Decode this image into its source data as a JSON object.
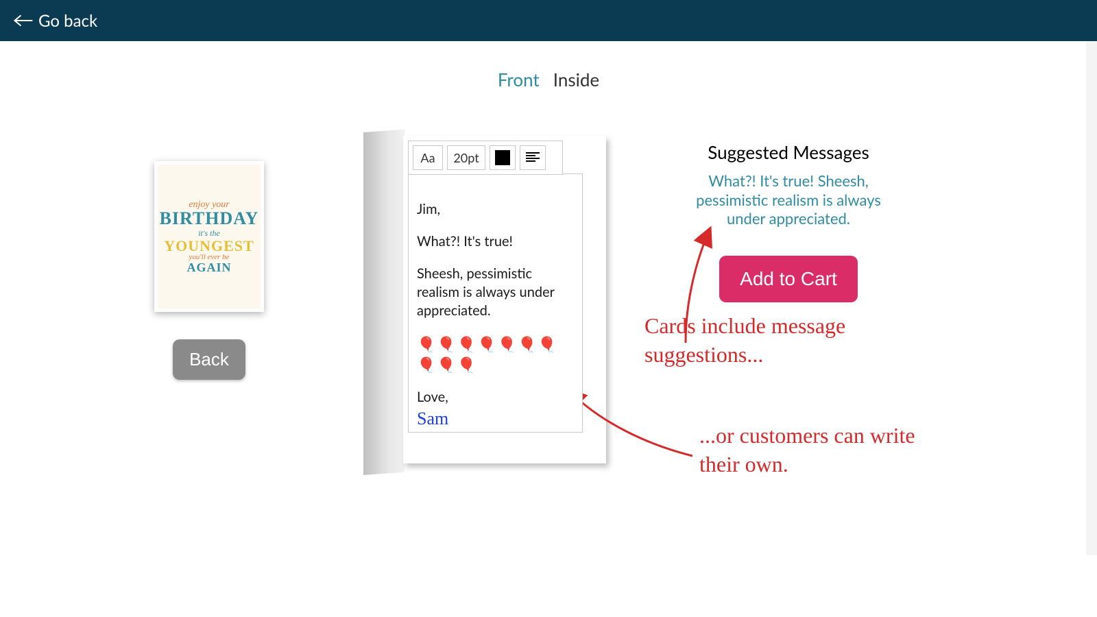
{
  "topbar": {
    "go_back": "Go back"
  },
  "tabs": {
    "front": "Front",
    "inside": "Inside",
    "active": "front"
  },
  "thumbnail": {
    "line1": "enjoy your",
    "line2": "BIRTHDAY",
    "line3": "it's the",
    "line4": "YOUNGEST",
    "line5": "you'll ever be",
    "line6": "AGAIN"
  },
  "left": {
    "back_button": "Back"
  },
  "toolbar": {
    "font_button": "Aa",
    "size_button": "20pt",
    "color_swatch": "#000000",
    "align_button": "align-left"
  },
  "message": {
    "greeting": "Jim,",
    "line1": "What?! It's true!",
    "line2": "Sheesh, pessimistic realism is always under appreciated.",
    "balloons": "🎈🎈🎈🎈🎈🎈🎈🎈🎈🎈",
    "closing": "Love,",
    "signature": "Sam"
  },
  "right": {
    "suggested_title": "Suggested Messages",
    "suggested_body": "What?! It's true! Sheesh, pessimistic realism is always under appreciated.",
    "add_to_cart": "Add to Cart"
  },
  "annotations": {
    "a1": "Cards include message suggestions...",
    "a2": "...or customers can write their own."
  }
}
